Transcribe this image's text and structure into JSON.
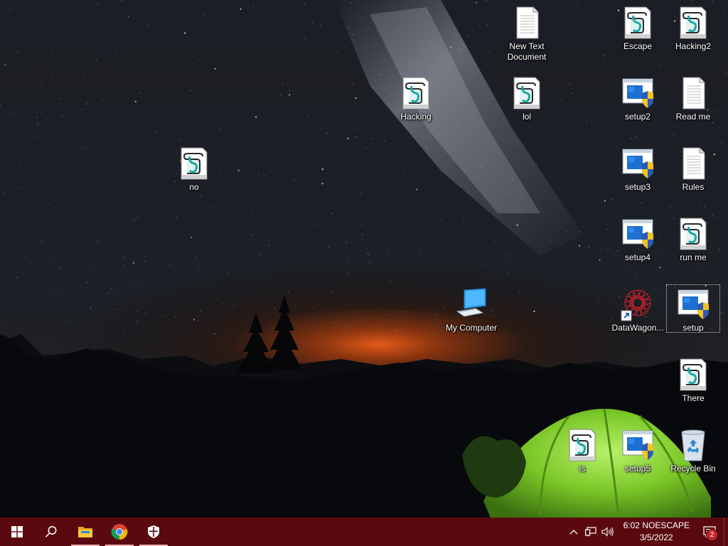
{
  "desktop": {
    "icons": [
      {
        "name": "New Text Document",
        "type": "text"
      },
      {
        "name": "Escape",
        "type": "script"
      },
      {
        "name": "Hacking2",
        "type": "script"
      },
      {
        "name": "Hacking",
        "type": "script"
      },
      {
        "name": "lol",
        "type": "script"
      },
      {
        "name": "setup2",
        "type": "setup"
      },
      {
        "name": "Read me",
        "type": "text"
      },
      {
        "name": "no",
        "type": "script"
      },
      {
        "name": "setup3",
        "type": "setup"
      },
      {
        "name": "Rules",
        "type": "text"
      },
      {
        "name": "setup4",
        "type": "setup"
      },
      {
        "name": "run me",
        "type": "script"
      },
      {
        "name": "My Computer",
        "type": "computer"
      },
      {
        "name": "DataWagon...",
        "type": "shortcut"
      },
      {
        "name": "setup",
        "type": "setup",
        "selected": true
      },
      {
        "name": "There",
        "type": "script"
      },
      {
        "name": "is",
        "type": "script"
      },
      {
        "name": "setup5",
        "type": "setup"
      },
      {
        "name": "Recycle Bin",
        "type": "recycle"
      }
    ]
  },
  "taskbar": {
    "color": "#5a0a0f",
    "buttons": [
      {
        "name": "start",
        "icon": "windows-logo-icon"
      },
      {
        "name": "search",
        "icon": "search-icon"
      },
      {
        "name": "file-explorer",
        "icon": "folder-icon",
        "running": true
      },
      {
        "name": "chrome",
        "icon": "chrome-icon",
        "running": true
      },
      {
        "name": "security",
        "icon": "shield-icon",
        "running": true
      }
    ],
    "clock": {
      "time": "6:02 NOESCAPE",
      "date": "3/5/2022"
    },
    "notification_count": "2"
  }
}
